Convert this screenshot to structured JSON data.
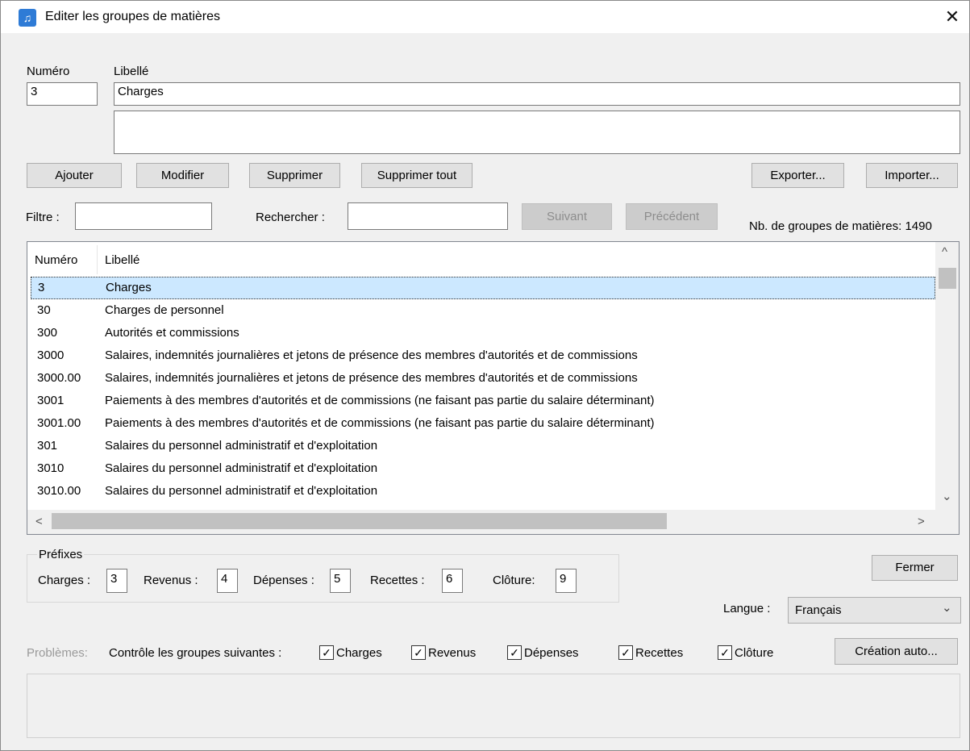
{
  "window": {
    "title": "Editer les groupes de matières",
    "close": "✕",
    "icon": "app-icon"
  },
  "form": {
    "numero_label": "Numéro",
    "numero_value": "3",
    "libelle_label": "Libellé",
    "libelle_value": "Charges",
    "description_value": ""
  },
  "toolbar": {
    "add": "Ajouter",
    "modify": "Modifier",
    "delete": "Supprimer",
    "delete_all": "Supprimer tout",
    "export": "Exporter...",
    "import": "Importer..."
  },
  "filter": {
    "filter_label": "Filtre :",
    "filter_value": "",
    "search_label": "Rechercher :",
    "search_value": "",
    "next": "Suivant",
    "previous": "Précédent",
    "count_text": "Nb. de groupes de matières: 1490"
  },
  "table": {
    "columns": [
      "Numéro",
      "Libellé"
    ],
    "rows": [
      {
        "num": "3",
        "label": "Charges",
        "selected": true
      },
      {
        "num": "30",
        "label": "Charges de personnel"
      },
      {
        "num": "300",
        "label": "Autorités et commissions"
      },
      {
        "num": "3000",
        "label": "Salaires, indemnités journalières et jetons de présence des membres d'autorités et de commissions"
      },
      {
        "num": "3000.00",
        "label": "Salaires, indemnités journalières et jetons de présence des membres d'autorités et de commissions"
      },
      {
        "num": "3001",
        "label": "Paiements à des membres d'autorités et de commissions (ne faisant pas partie du salaire déterminant)"
      },
      {
        "num": "3001.00",
        "label": "Paiements à des membres d'autorités et de commissions (ne faisant pas partie du salaire déterminant)"
      },
      {
        "num": "301",
        "label": "Salaires du personnel administratif et d'exploitation"
      },
      {
        "num": "3010",
        "label": "Salaires du personnel administratif et d'exploitation"
      },
      {
        "num": "3010.00",
        "label": "Salaires du personnel administratif et d'exploitation"
      }
    ],
    "scroll_up": "^",
    "scroll_down": "⌄",
    "scroll_left": "<",
    "scroll_right": ">"
  },
  "prefixes": {
    "group_label": "Préfixes",
    "charges_label": "Charges :",
    "charges_value": "3",
    "revenus_label": "Revenus :",
    "revenus_value": "4",
    "depenses_label": "Dépenses :",
    "depenses_value": "5",
    "recettes_label": "Recettes :",
    "recettes_value": "6",
    "cloture_label": "Clôture:",
    "cloture_value": "9"
  },
  "close_button": "Fermer",
  "language": {
    "label": "Langue :",
    "value": "Français",
    "arrow": "⌄"
  },
  "problems": {
    "label": "Problèmes:",
    "control_label": "Contrôle les groupes suivantes :",
    "checks": [
      {
        "label": "Charges",
        "checked": true
      },
      {
        "label": "Revenus",
        "checked": true
      },
      {
        "label": "Dépenses",
        "checked": true
      },
      {
        "label": "Recettes",
        "checked": true
      },
      {
        "label": "Clôture",
        "checked": true
      }
    ],
    "auto_create": "Création auto...",
    "check_mark": "✓"
  },
  "colors": {
    "selection": "#cce8ff",
    "window_bg": "#f0f0f0",
    "disabled_text": "#8d8d8d"
  }
}
